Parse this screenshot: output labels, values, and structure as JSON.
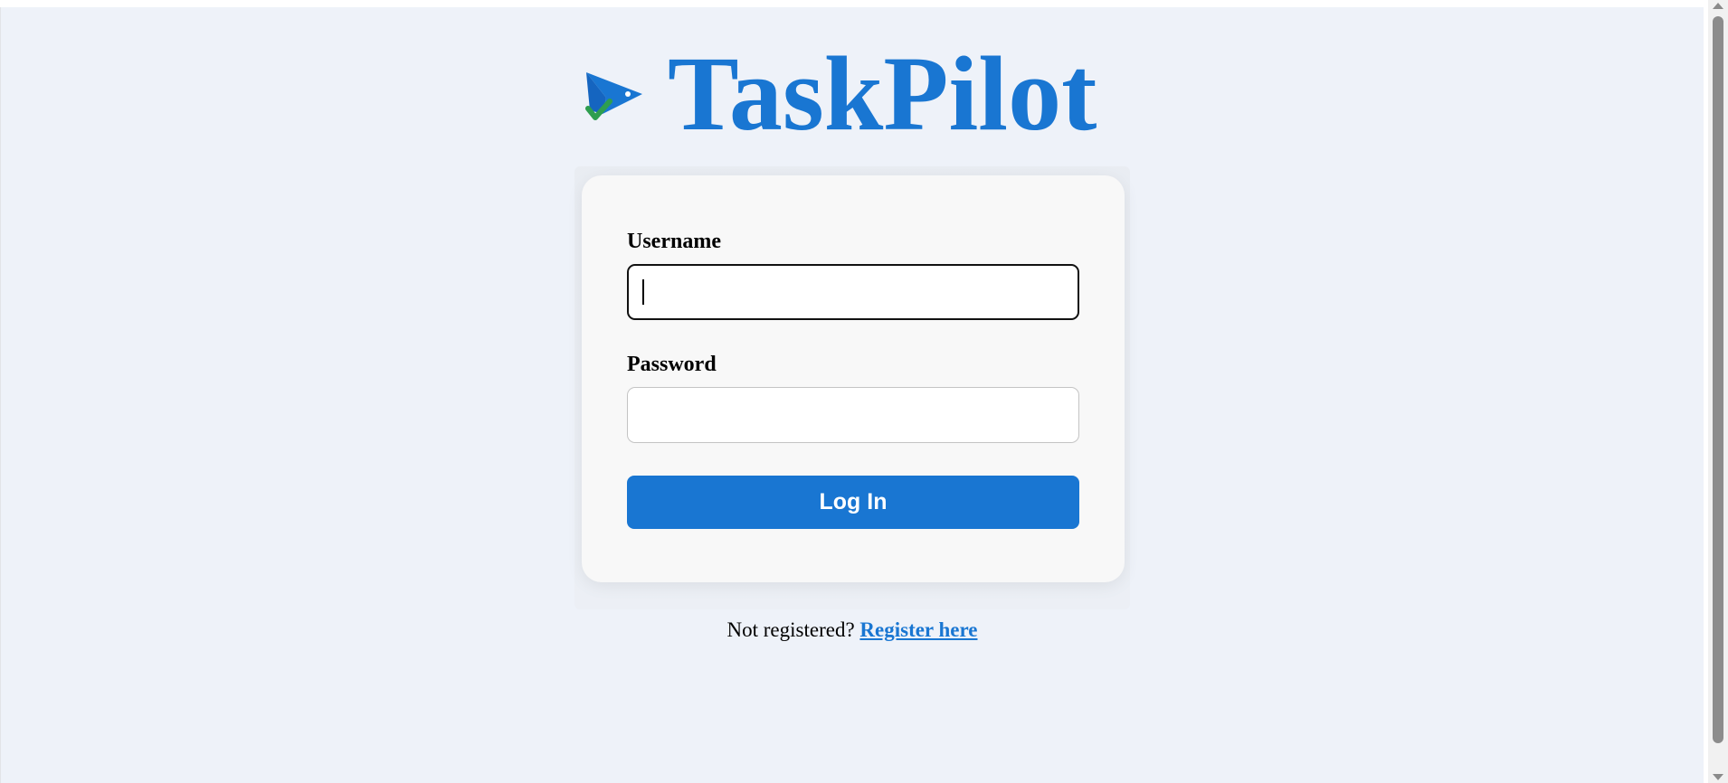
{
  "app": {
    "name": "TaskPilot",
    "brand_color": "#1976d2",
    "accent_check_color": "#2e9e4f"
  },
  "logo": {
    "icon": "paper-plane-check-icon"
  },
  "login_form": {
    "username_label": "Username",
    "username_value": "",
    "password_label": "Password",
    "password_value": "",
    "submit_label": "Log In"
  },
  "register": {
    "prompt": "Not registered?",
    "link_label": "Register here"
  }
}
